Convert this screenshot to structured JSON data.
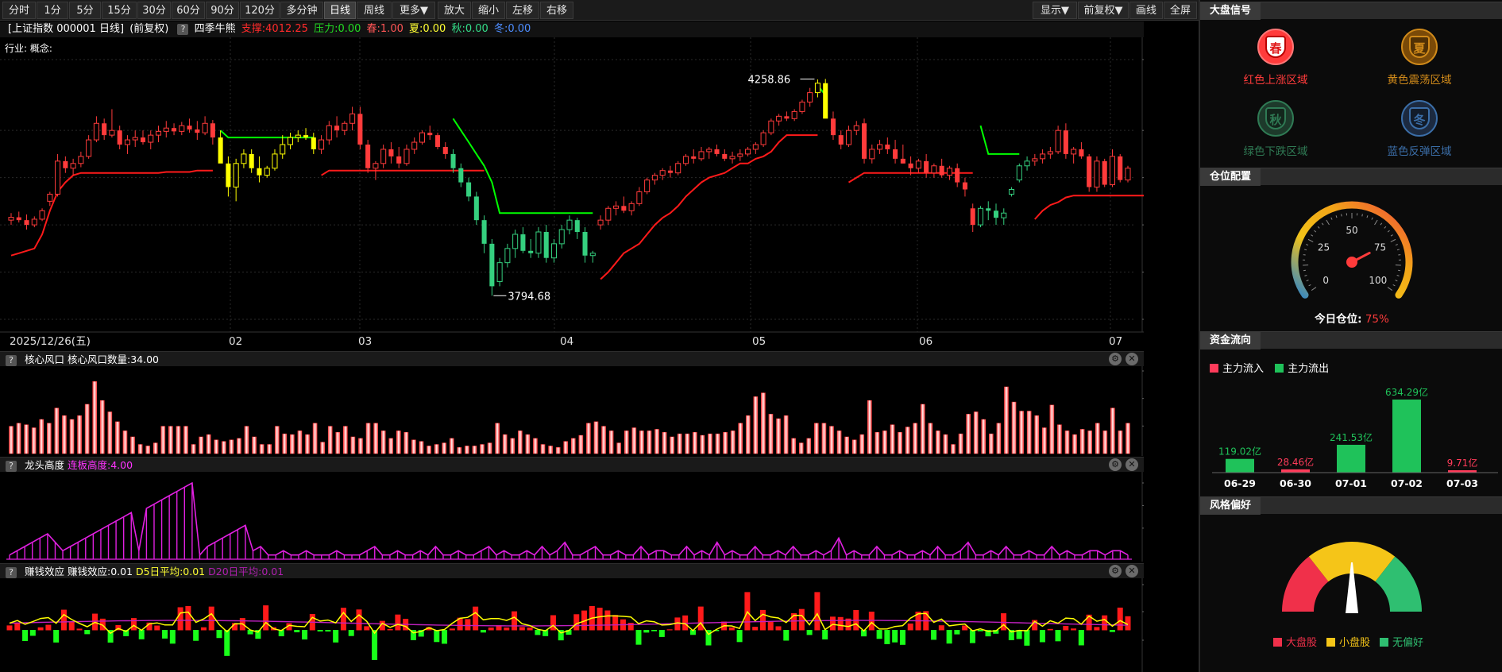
{
  "toolbar": {
    "periods": [
      "分时",
      "1分",
      "5分",
      "15分",
      "30分",
      "60分",
      "90分",
      "120分",
      "多分钟",
      "日线",
      "周线",
      "更多▼"
    ],
    "active_period": "日线",
    "actions": [
      "放大",
      "缩小",
      "左移",
      "右移"
    ],
    "right": [
      "显示▼",
      "前复权▼",
      "画线",
      "全屏"
    ]
  },
  "header": {
    "symbol": "[上证指数 000001 日线]",
    "adjust": "(前复权)",
    "help": "?",
    "indicator": "四季牛熊",
    "support": "支撑:4012.25",
    "pressure": "压力:0.00",
    "spring": "春:1.00",
    "summer": "夏:0.00",
    "autumn": "秋:0.00",
    "winter": "冬:0.00",
    "industry": "行业: 概念:"
  },
  "colors": {
    "up": "#ff3b3b",
    "down": "#35d07f",
    "yellow": "#ffff00",
    "green_line": "#00ff00",
    "red_line": "#ff1a1a",
    "magenta": "#e020e0",
    "salmon": "#ff8080"
  },
  "main_chart": {
    "y_ticks": [
      "4300.0",
      "4150.0",
      "4050.0",
      "3950.0",
      "3850.0",
      "3750.0"
    ],
    "x_labels": [
      "2025/12/26(五)",
      "02",
      "03",
      "04",
      "05",
      "06",
      "07"
    ],
    "high_label": "4258.86",
    "low_label": "3794.68"
  },
  "panel_wind": {
    "help": "?",
    "name": "核心风口",
    "value_label": "核心风口数量:34.00",
    "y_ticks": [
      "109.00",
      "72.67",
      "36.33"
    ],
    "settings_icon": "gear-icon",
    "close_icon": "close-icon"
  },
  "panel_dragon": {
    "help": "?",
    "name": "龙头高度",
    "value_label": "连板高度:4.00",
    "y_ticks": [
      "18.00",
      "12.67",
      "7.33"
    ],
    "settings_icon": "gear-icon",
    "close_icon": "close-icon"
  },
  "panel_money": {
    "help": "?",
    "name": "赚钱效应",
    "value_label": "赚钱效应:0.01",
    "d5": "D5日平均:0.01",
    "d20": "D20日平均:0.01",
    "y_ticks": [
      "0.03",
      "0.01",
      "-0.01"
    ],
    "settings_icon": "gear-icon",
    "close_icon": "close-icon"
  },
  "sidebar": {
    "signal_title": "大盘信号",
    "signals": [
      {
        "glyph": "春",
        "label": "红色上涨区域",
        "color": "#ff3b3b"
      },
      {
        "glyph": "夏",
        "label": "黄色震荡区域",
        "color": "#d08a1a"
      },
      {
        "glyph": "秋",
        "label": "绿色下跌区域",
        "color": "#2f7a54"
      },
      {
        "glyph": "冬",
        "label": "蓝色反弹区域",
        "color": "#3b6ea8"
      }
    ],
    "position_title": "仓位配置",
    "gauge_ticks": [
      "0",
      "25",
      "50",
      "75",
      "100"
    ],
    "gauge_value": 75,
    "position_label": "今日仓位:",
    "position_value": "75%",
    "flow_title": "资金流向",
    "flow_legend_in": "主力流入",
    "flow_legend_out": "主力流出",
    "flows": [
      {
        "date": "06-29",
        "value_label": "119.02亿",
        "value": 119.02,
        "dir": "out"
      },
      {
        "date": "06-30",
        "value_label": "28.46亿",
        "value": 28.46,
        "dir": "in"
      },
      {
        "date": "07-01",
        "value_label": "241.53亿",
        "value": 241.53,
        "dir": "out"
      },
      {
        "date": "07-02",
        "value_label": "634.29亿",
        "value": 634.29,
        "dir": "out"
      },
      {
        "date": "07-03",
        "value_label": "9.71亿",
        "value": 9.71,
        "dir": "in"
      }
    ],
    "style_title": "风格偏好",
    "style_legend": [
      "大盘股",
      "小盘股",
      "无偏好"
    ],
    "style_colors": [
      "#f0304a",
      "#f5c518",
      "#2fbf71"
    ]
  },
  "chart_data": {
    "type": "candlestick",
    "title": "上证指数 000001 日线",
    "ylim": [
      3750,
      4300
    ],
    "candles": [
      [
        3960,
        3975,
        3950,
        3966
      ],
      [
        3966,
        3978,
        3955,
        3960
      ],
      [
        3960,
        3972,
        3940,
        3950
      ],
      [
        3950,
        3968,
        3945,
        3962
      ],
      [
        3962,
        3985,
        3958,
        3980
      ],
      [
        4000,
        4020,
        3990,
        4015
      ],
      [
        4015,
        4100,
        4010,
        4085
      ],
      [
        4085,
        4095,
        4060,
        4070
      ],
      [
        4070,
        4090,
        4055,
        4080
      ],
      [
        4080,
        4105,
        4072,
        4095
      ],
      [
        4095,
        4140,
        4090,
        4130
      ],
      [
        4130,
        4180,
        4125,
        4165
      ],
      [
        4165,
        4175,
        4130,
        4140
      ],
      [
        4140,
        4195,
        4135,
        4150
      ],
      [
        4150,
        4160,
        4110,
        4120
      ],
      [
        4120,
        4140,
        4100,
        4130
      ],
      [
        4130,
        4150,
        4115,
        4135
      ],
      [
        4135,
        4150,
        4120,
        4125
      ],
      [
        4125,
        4150,
        4110,
        4140
      ],
      [
        4140,
        4160,
        4125,
        4148
      ],
      [
        4148,
        4170,
        4135,
        4155
      ],
      [
        4155,
        4165,
        4140,
        4148
      ],
      [
        4148,
        4168,
        4140,
        4160
      ],
      [
        4160,
        4175,
        4145,
        4152
      ],
      [
        4152,
        4170,
        4130,
        4145
      ],
      [
        4145,
        4180,
        4140,
        4165
      ],
      [
        4165,
        4172,
        4120,
        4135
      ],
      [
        4135,
        4150,
        4110,
        4080
      ],
      [
        4080,
        4095,
        4010,
        4030
      ],
      [
        4030,
        4090,
        4000,
        4080
      ],
      [
        4080,
        4110,
        4070,
        4100
      ],
      [
        4100,
        4110,
        4060,
        4070
      ],
      [
        4070,
        4095,
        4040,
        4055
      ],
      [
        4055,
        4075,
        4050,
        4070
      ],
      [
        4070,
        4110,
        4065,
        4100
      ],
      [
        4100,
        4140,
        4090,
        4120
      ],
      [
        4120,
        4145,
        4110,
        4135
      ],
      [
        4135,
        4150,
        4125,
        4140
      ],
      [
        4140,
        4155,
        4130,
        4135
      ],
      [
        4135,
        4145,
        4100,
        4110
      ],
      [
        4110,
        4140,
        4100,
        4130
      ],
      [
        4130,
        4170,
        4120,
        4160
      ],
      [
        4160,
        4180,
        4135,
        4150
      ],
      [
        4150,
        4170,
        4140,
        4165
      ],
      [
        4165,
        4200,
        4150,
        4185
      ],
      [
        4185,
        4200,
        4110,
        4120
      ],
      [
        4120,
        4130,
        4060,
        4070
      ],
      [
        4070,
        4085,
        4045,
        4080
      ],
      [
        4080,
        4120,
        4070,
        4110
      ],
      [
        4110,
        4125,
        4080,
        4095
      ],
      [
        4095,
        4115,
        4070,
        4080
      ],
      [
        4080,
        4120,
        4075,
        4110
      ],
      [
        4110,
        4135,
        4100,
        4125
      ],
      [
        4125,
        4150,
        4120,
        4145
      ],
      [
        4145,
        4160,
        4130,
        4140
      ],
      [
        4140,
        4145,
        4110,
        4115
      ],
      [
        4115,
        4125,
        4090,
        4100
      ],
      [
        4100,
        4110,
        4060,
        4070
      ],
      [
        4070,
        4080,
        4030,
        4040
      ],
      [
        4040,
        4050,
        4000,
        4010
      ],
      [
        4010,
        4020,
        3950,
        3960
      ],
      [
        3960,
        3970,
        3890,
        3910
      ],
      [
        3910,
        3920,
        3800,
        3820
      ],
      [
        3830,
        3880,
        3820,
        3870
      ],
      [
        3870,
        3910,
        3860,
        3900
      ],
      [
        3900,
        3940,
        3880,
        3930
      ],
      [
        3930,
        3945,
        3890,
        3895
      ],
      [
        3895,
        3920,
        3880,
        3890
      ],
      [
        3890,
        3945,
        3880,
        3935
      ],
      [
        3935,
        3950,
        3870,
        3880
      ],
      [
        3880,
        3920,
        3870,
        3910
      ],
      [
        3910,
        3950,
        3900,
        3940
      ],
      [
        3940,
        3970,
        3930,
        3960
      ],
      [
        3960,
        3965,
        3920,
        3935
      ],
      [
        3935,
        3945,
        3870,
        3885
      ],
      [
        3885,
        3895,
        3870,
        3890
      ],
      [
        3950,
        3970,
        3940,
        3960
      ],
      [
        3960,
        3990,
        3950,
        3985
      ],
      [
        3985,
        4000,
        3970,
        3990
      ],
      [
        3990,
        4010,
        3975,
        3980
      ],
      [
        3980,
        4000,
        3970,
        3995
      ],
      [
        3995,
        4030,
        3990,
        4020
      ],
      [
        4020,
        4050,
        4015,
        4045
      ],
      [
        4045,
        4060,
        4035,
        4055
      ],
      [
        4055,
        4070,
        4045,
        4065
      ],
      [
        4065,
        4075,
        4050,
        4060
      ],
      [
        4060,
        4085,
        4055,
        4080
      ],
      [
        4080,
        4100,
        4075,
        4095
      ],
      [
        4095,
        4110,
        4080,
        4090
      ],
      [
        4090,
        4115,
        4085,
        4105
      ],
      [
        4105,
        4115,
        4090,
        4110
      ],
      [
        4110,
        4120,
        4095,
        4100
      ],
      [
        4100,
        4110,
        4085,
        4090
      ],
      [
        4090,
        4105,
        4080,
        4095
      ],
      [
        4095,
        4110,
        4085,
        4100
      ],
      [
        4100,
        4115,
        4095,
        4110
      ],
      [
        4110,
        4125,
        4100,
        4120
      ],
      [
        4120,
        4150,
        4115,
        4145
      ],
      [
        4145,
        4175,
        4140,
        4170
      ],
      [
        4170,
        4185,
        4160,
        4180
      ],
      [
        4180,
        4190,
        4170,
        4175
      ],
      [
        4175,
        4195,
        4170,
        4190
      ],
      [
        4190,
        4215,
        4185,
        4210
      ],
      [
        4210,
        4240,
        4200,
        4230
      ],
      [
        4230,
        4258,
        4220,
        4250
      ],
      [
        4250,
        4259,
        4200,
        4175
      ],
      [
        4175,
        4190,
        4130,
        4140
      ],
      [
        4140,
        4150,
        4110,
        4120
      ],
      [
        4120,
        4160,
        4115,
        4150
      ],
      [
        4150,
        4170,
        4140,
        4160
      ],
      [
        4165,
        4175,
        4080,
        4090
      ],
      [
        4090,
        4120,
        4080,
        4110
      ],
      [
        4110,
        4130,
        4100,
        4120
      ],
      [
        4120,
        4135,
        4100,
        4110
      ],
      [
        4110,
        4130,
        4080,
        4090
      ],
      [
        4090,
        4120,
        4080,
        4080
      ],
      [
        4080,
        4095,
        4055,
        4070
      ],
      [
        4070,
        4090,
        4060,
        4085
      ],
      [
        4085,
        4100,
        4050,
        4060
      ],
      [
        4060,
        4080,
        4050,
        4075
      ],
      [
        4075,
        4090,
        4050,
        4055
      ],
      [
        4055,
        4075,
        4045,
        4070
      ],
      [
        4070,
        4080,
        4030,
        4040
      ],
      [
        4040,
        4050,
        4010,
        4025
      ],
      [
        3985,
        3995,
        3935,
        3950
      ],
      [
        3950,
        3990,
        3945,
        3985
      ],
      [
        3985,
        4000,
        3960,
        3980
      ],
      [
        3980,
        3995,
        3950,
        3965
      ],
      [
        3965,
        3985,
        3950,
        3975
      ],
      [
        4015,
        4030,
        4010,
        4025
      ],
      [
        4045,
        4080,
        4040,
        4075
      ],
      [
        4075,
        4095,
        4065,
        4085
      ],
      [
        4085,
        4100,
        4075,
        4090
      ],
      [
        4090,
        4110,
        4080,
        4100
      ],
      [
        4100,
        4115,
        4090,
        4105
      ],
      [
        4105,
        4160,
        4100,
        4150
      ],
      [
        4150,
        4165,
        4090,
        4100
      ],
      [
        4100,
        4115,
        4080,
        4110
      ],
      [
        4110,
        4125,
        4090,
        4095
      ],
      [
        4095,
        4100,
        4020,
        4030
      ],
      [
        4030,
        4095,
        4020,
        4085
      ],
      [
        4085,
        4090,
        4030,
        4035
      ],
      [
        4035,
        4110,
        4030,
        4095
      ],
      [
        4095,
        4100,
        4040,
        4045
      ],
      [
        4045,
        4075,
        4040,
        4070
      ]
    ],
    "support_segments": [
      {
        "color": "red",
        "start": 0,
        "values": [
          3885,
          3890,
          3895,
          3900,
          3930,
          3980,
          4020,
          4040,
          4055,
          4060,
          4060,
          4060,
          4060,
          4060,
          4060,
          4060,
          4060,
          4060,
          4060,
          4060,
          4062,
          4062,
          4062,
          4062,
          4065,
          4065,
          4065
        ]
      },
      {
        "color": "green",
        "start": 27,
        "values": [
          4150,
          4135,
          4135,
          4135,
          4135,
          4135,
          4135,
          4135,
          4135,
          4135,
          4135,
          4135,
          4135
        ]
      },
      {
        "color": "red",
        "start": 40,
        "values": [
          4055,
          4065,
          4065,
          4065,
          4065,
          4065,
          4065,
          4065,
          4065,
          4065,
          4065,
          4065,
          4065,
          4065,
          4065,
          4065,
          4065,
          4065,
          4065,
          4065,
          4065,
          4065
        ]
      },
      {
        "color": "green",
        "start": 57,
        "values": [
          4175,
          4150,
          4125,
          4100,
          4075,
          4040,
          3975,
          3975,
          3975,
          3975,
          3975,
          3975,
          3975,
          3975,
          3975,
          3975,
          3975,
          3975,
          3975
        ]
      },
      {
        "color": "red",
        "start": 76,
        "values": [
          3835,
          3850,
          3870,
          3890,
          3900,
          3910,
          3930,
          3950,
          3965,
          3975,
          3990,
          4010,
          4025,
          4040,
          4050,
          4055,
          4060,
          4070,
          4080,
          4080,
          4090,
          4095,
          4105,
          4125,
          4140,
          4140,
          4140,
          4140,
          4140
        ]
      },
      {
        "color": "green",
        "start": 104,
        "values": [
          4245,
          4225
        ]
      },
      {
        "color": "red",
        "start": 108,
        "values": [
          4040,
          4050,
          4060,
          4060,
          4060,
          4060,
          4060,
          4060,
          4060,
          4060,
          4060,
          4060,
          4060,
          4060,
          4060,
          4060,
          4060
        ]
      },
      {
        "color": "green",
        "start": 125,
        "values": [
          4160,
          4100,
          4100,
          4100,
          4100,
          4100
        ]
      },
      {
        "color": "red",
        "start": 132,
        "values": [
          3962,
          3980,
          3992,
          3998,
          4008,
          4012,
          4012,
          4012,
          4012,
          4012,
          4012,
          4012,
          4012,
          4012,
          4012,
          4012,
          4012
        ]
      }
    ],
    "wind_values": [
      36,
      40,
      38,
      34,
      45,
      40,
      60,
      50,
      45,
      50,
      65,
      95,
      70,
      55,
      42,
      30,
      22,
      12,
      10,
      14,
      36,
      36,
      36,
      36,
      12,
      22,
      25,
      18,
      16,
      18,
      20,
      36,
      22,
      12,
      12,
      36,
      26,
      25,
      30,
      25,
      40,
      15,
      36,
      28,
      36,
      22,
      20,
      40,
      40,
      30,
      20,
      30,
      28,
      18,
      16,
      10,
      12,
      14,
      20,
      8,
      10,
      10,
      12,
      14,
      40,
      25,
      20,
      30,
      25,
      20,
      12,
      10,
      8,
      16,
      20,
      24,
      40,
      42,
      36,
      30,
      14,
      30,
      34,
      30,
      30,
      32,
      28,
      22,
      26,
      26,
      28,
      24,
      26,
      26,
      28,
      30,
      40,
      50,
      75,
      80,
      52,
      46,
      50,
      20,
      14,
      20,
      40,
      40,
      36,
      30,
      22,
      18,
      25,
      70,
      28,
      30,
      38,
      28,
      35,
      40,
      65,
      40,
      30,
      25,
      12,
      26,
      52,
      55,
      45,
      26,
      40,
      88,
      68,
      56,
      56,
      50,
      34,
      64,
      38,
      30,
      25,
      32,
      30,
      40,
      30,
      60,
      30,
      40
    ]
  }
}
